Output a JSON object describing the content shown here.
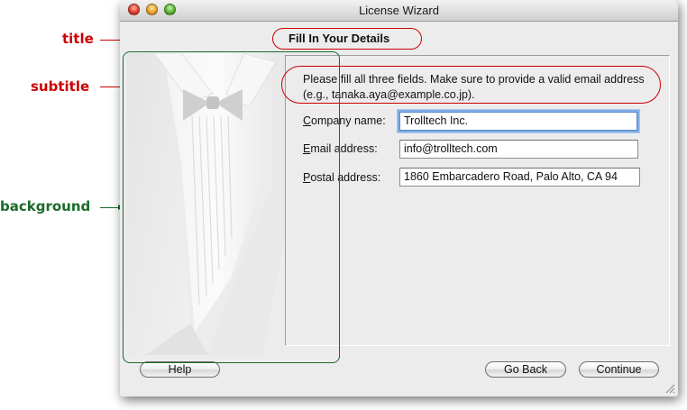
{
  "annotations": {
    "title_label": "title",
    "subtitle_label": "subtitle",
    "background_label": "background",
    "red_color": "#cc0000",
    "green_color": "#1a6b2b"
  },
  "window": {
    "title": "License Wizard",
    "controls": [
      "close",
      "minimize",
      "maximize"
    ]
  },
  "page": {
    "title": "Fill In Your Details",
    "subtitle": "Please fill all three fields. Make sure to provide a valid email address (e.g., tanaka.aya@example.co.jp)."
  },
  "form": {
    "company": {
      "mnemonic": "C",
      "label_rest": "ompany name:",
      "value": "Trolltech Inc."
    },
    "email": {
      "mnemonic": "E",
      "label_rest": "mail address:",
      "value": "info@trolltech.com"
    },
    "postal": {
      "mnemonic": "P",
      "label_rest": "ostal address:",
      "value": "1860 Embarcadero Road, Palo Alto, CA 94"
    }
  },
  "buttons": {
    "help": "Help",
    "back": "Go Back",
    "next": "Continue"
  },
  "icons": {
    "watermark": "tuxedo-watermark-icon",
    "resize": "resize-grip-icon"
  }
}
